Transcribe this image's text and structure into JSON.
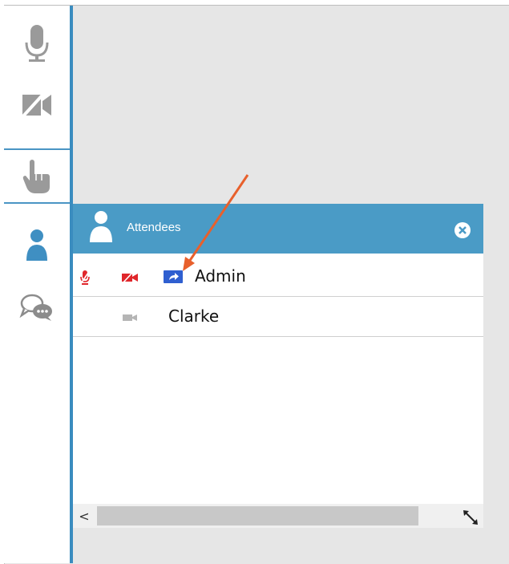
{
  "toolbar": {
    "items": [
      {
        "icon": "microphone-icon"
      },
      {
        "icon": "video-off-icon"
      },
      {
        "icon": "raise-hand-icon"
      },
      {
        "icon": "attendees-icon"
      },
      {
        "icon": "chat-icon"
      }
    ],
    "accent_color": "#3a8cbf"
  },
  "attendees_panel": {
    "title": "Attendees",
    "header_color": "#4a9bc6",
    "attendees": [
      {
        "name": "Admin",
        "status_icons": [
          "mic-muted-icon",
          "camera-off-icon",
          "screen-share-icon"
        ]
      },
      {
        "name": "Clarke",
        "status_icons": [
          "camera-icon"
        ]
      }
    ],
    "scroll_left": "<"
  },
  "annotation": {
    "type": "arrow",
    "color": "#e8602c"
  }
}
